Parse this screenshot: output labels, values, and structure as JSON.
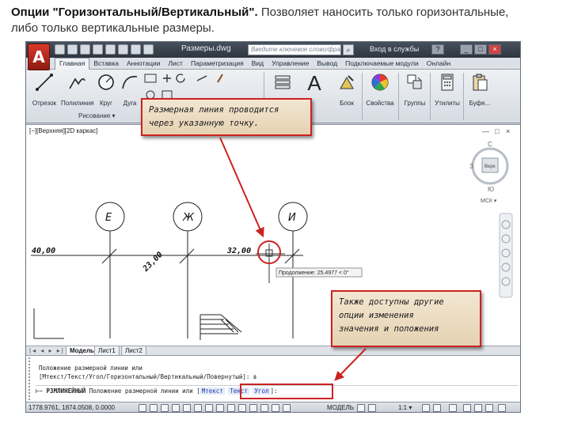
{
  "caption": {
    "bold": "Опции \"Горизонтальный/Вертикальный\".",
    "line1_rest": " Позволяет наносить только горизонтальные,",
    "line2": "либо только вертикальные размеры."
  },
  "titlebar": {
    "logo": "A",
    "doc_title": "Размеры.dwg",
    "search_placeholder": "Введите ключевое слово/фразу",
    "signin": "Вход в службы",
    "help": "?",
    "minimize": "_",
    "maximize": "□",
    "close": "×"
  },
  "tabs": [
    "Главная",
    "Вставка",
    "Аннотации",
    "Лист",
    "Параметризация",
    "Вид",
    "Управление",
    "Вывод",
    "Подключаемые модули",
    "Онлайн"
  ],
  "ribbon": {
    "tools": {
      "otrezok": "Отрезок",
      "polyline": "Полилиния",
      "krug": "Круг",
      "duga": "Дуга",
      "blok": "Блок",
      "svoistva": "Свойства",
      "gruppy": "Группы",
      "utility": "Утилиты",
      "bufer": "Буфе..."
    },
    "panel_risovanie": "Рисование ▾",
    "text_big": "A"
  },
  "viewport": {
    "label": "[−][Верхняя][2D каркас]",
    "minimize": "—",
    "restore": "□",
    "close": "×",
    "viewcube": {
      "north": "С",
      "west": "З",
      "south": "Ю",
      "face": "Верх",
      "wcs": "МСК ▾"
    },
    "axes": {
      "e": "Е",
      "zh": "Ж",
      "i": "И"
    },
    "dim1": "40,00",
    "dim2": "23,00",
    "dim3": "32,00",
    "tooltip": "Продолжение: 25.4977 < 0°"
  },
  "layout_tabs": {
    "nav": "|◂ ◂ ▸ ▸|",
    "tabs": [
      "Модель",
      "Лист1",
      "Лист2"
    ]
  },
  "command": {
    "line1": "Положение размерной линии или",
    "line2": "[Мтекст/Текст/Угол/Горизонтальный/Вертикальный/Повернутый]: в",
    "prefix": "РЗМЛИНЕЙНЫЙ",
    "prompt": "Положение размерной линии или [",
    "opt1": "Мтекст",
    "opt2": "Текст",
    "opt3": "Угол",
    "suffix": "]:"
  },
  "statusbar": {
    "coords": "1778.9761, 1874.0508, 0.0000",
    "model": "МОДЕЛЬ",
    "scale": "1:1 ▾"
  },
  "callouts": {
    "top": [
      "Размерная линия проводится",
      "через указанную точку."
    ],
    "bottom": [
      "Также доступны другие",
      "опции изменения",
      "значения и положения"
    ]
  },
  "colors": {
    "callout_border": "#cc2222",
    "logo_red": "#c62d1f",
    "title_dark": "#3a424d"
  }
}
